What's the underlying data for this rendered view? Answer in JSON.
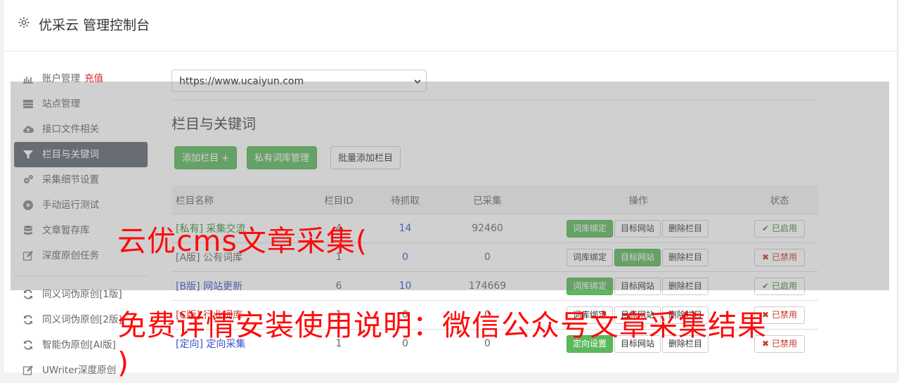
{
  "app": {
    "title": "优采云 管理控制台"
  },
  "sidebar": {
    "items": [
      {
        "label": "账户管理",
        "badge": "充值",
        "icon": "bar-chart-icon"
      },
      {
        "label": "站点管理",
        "icon": "server-icon"
      },
      {
        "label": "接口文件相关",
        "icon": "cloud-upload-icon"
      },
      {
        "label": "栏目与关键词",
        "icon": "filter-icon",
        "active": true
      },
      {
        "label": "采集细节设置",
        "icon": "cogs-icon"
      },
      {
        "label": "手动运行测试",
        "icon": "play-circle-icon"
      },
      {
        "label": "文章暂存库",
        "icon": "database-icon"
      },
      {
        "label": "深度原创任务",
        "icon": "edit-icon"
      },
      {
        "label": "同义词伪原创[1版]",
        "icon": "refresh-icon"
      },
      {
        "label": "同义词伪原创[2版]",
        "icon": "refresh-icon"
      },
      {
        "label": "智能伪原创[AI版]",
        "icon": "refresh-icon"
      },
      {
        "label": "UWriter深度原创",
        "icon": "edit-icon"
      }
    ]
  },
  "site_select": {
    "value": "https://www.ucaiyun.com"
  },
  "section": {
    "title": "栏目与关键词"
  },
  "toolbar": {
    "add_label": "添加栏目 +",
    "lib_label": "私有词库管理",
    "batch_label": "批量添加栏目"
  },
  "table": {
    "headers": [
      "栏目名称",
      "栏目ID",
      "待抓取",
      "已采集",
      "操作",
      "状态"
    ],
    "rows": [
      {
        "tag": "[私有]",
        "name": "采集交流",
        "id": "4",
        "pending": "14",
        "collected": "92460",
        "ops": [
          "词库绑定",
          "目标网站",
          "删除栏目"
        ],
        "ops_green": [
          true,
          false,
          false
        ],
        "status": "已启用",
        "status_on": true
      },
      {
        "tag": "[A版]",
        "name": "公有词库",
        "id": "1",
        "pending": "0",
        "collected": "0",
        "ops": [
          "词库绑定",
          "目标网站",
          "删除栏目"
        ],
        "ops_green": [
          false,
          true,
          false
        ],
        "status": "已禁用",
        "status_on": false
      },
      {
        "tag": "[B版]",
        "name": "网站更新",
        "id": "6",
        "pending": "10",
        "collected": "174669",
        "ops": [
          "词库绑定",
          "目标网站",
          "删除栏目"
        ],
        "ops_green": [
          true,
          false,
          false
        ],
        "status": "已启用",
        "status_on": true
      },
      {
        "tag": "[C版]",
        "name": "行业词库",
        "id": "1",
        "pending": "0",
        "collected": "0",
        "ops": [
          "词库绑定",
          "目标网站",
          "删除栏目"
        ],
        "ops_green": [
          false,
          false,
          false
        ],
        "status": "已禁用",
        "status_on": false
      },
      {
        "tag": "[定向]",
        "name": "定向采集",
        "id": "1",
        "pending": "0",
        "collected": "0",
        "ops": [
          "定向设置",
          "目标网站",
          "删除栏目"
        ],
        "ops_green": [
          true,
          false,
          false
        ],
        "status": "已禁用",
        "status_on": false
      }
    ]
  },
  "watermark": {
    "line1": "云优cms文章采集(",
    "line2": "免费详情安装使用说明：微信公众号文章采集结果",
    "line3": ")"
  },
  "colors": {
    "accent_green": "#5cb85c",
    "active_nav": "#5f6770",
    "watermark_red": "#ff0a0a"
  }
}
